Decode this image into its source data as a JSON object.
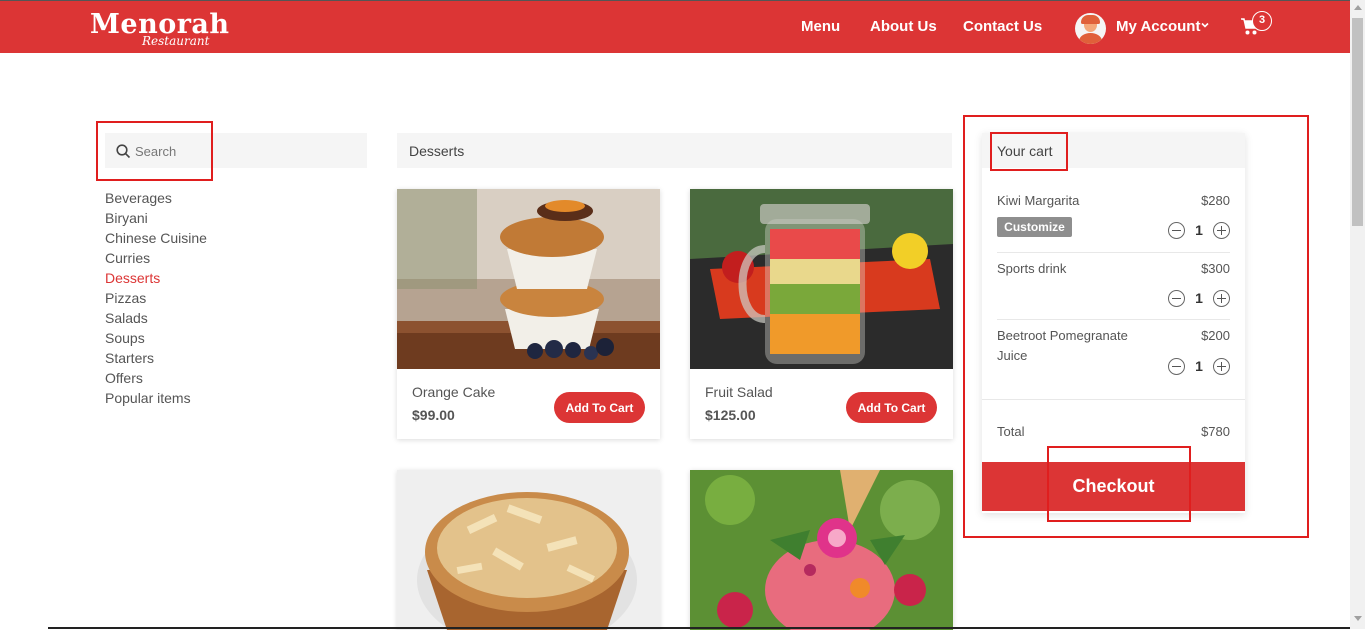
{
  "header": {
    "logo_main": "Menorah",
    "logo_sub": "Restaurant",
    "nav": {
      "menu": "Menu",
      "about": "About Us",
      "contact": "Contact Us"
    },
    "account_label": "My Account",
    "cart_count": "3",
    "colors": {
      "brand": "#dc3535"
    }
  },
  "sidebar": {
    "search_placeholder": "Search",
    "categories": [
      "Beverages",
      "Biryani",
      "Chinese Cuisine",
      "Curries",
      "Desserts",
      "Pizzas",
      "Salads",
      "Soups",
      "Starters",
      "Offers",
      "Popular items"
    ],
    "active_category": "Desserts"
  },
  "products": {
    "section_title": "Desserts",
    "add_label": "Add To Cart",
    "items": [
      {
        "name": "Orange Cake",
        "price": "$99.00"
      },
      {
        "name": "Fruit Salad",
        "price": "$125.00"
      },
      {
        "name": "",
        "price": ""
      },
      {
        "name": "",
        "price": ""
      }
    ]
  },
  "cart": {
    "title": "Your cart",
    "items": [
      {
        "name": "Kiwi Margarita",
        "price": "$280",
        "qty": "1",
        "customize": "Customize"
      },
      {
        "name": "Sports drink",
        "price": "$300",
        "qty": "1"
      },
      {
        "name": "Beetroot Pomegranate Juice",
        "price": "$200",
        "qty": "1"
      }
    ],
    "total_label": "Total",
    "total_value": "$780",
    "checkout_label": "Checkout"
  }
}
